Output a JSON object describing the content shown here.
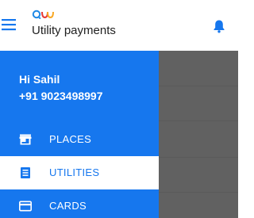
{
  "header": {
    "title": "Utility payments",
    "menu_icon": "hamburger-menu-icon",
    "logo": "brand-logo",
    "notification_icon": "bell-icon"
  },
  "drawer": {
    "greeting": "Hi Sahil",
    "phone": "+91 9023498997",
    "items": [
      {
        "label": "PLACES",
        "icon": "store-icon",
        "active": false
      },
      {
        "label": "UTILITIES",
        "icon": "list-icon",
        "active": true
      },
      {
        "label": "CARDS",
        "icon": "credit-card-icon",
        "active": false
      }
    ]
  },
  "colors": {
    "primary": "#1677ee",
    "scrim": "#616161",
    "logo_blue": "#1e88e5",
    "logo_red": "#e53935",
    "logo_yellow": "#f9a825"
  }
}
